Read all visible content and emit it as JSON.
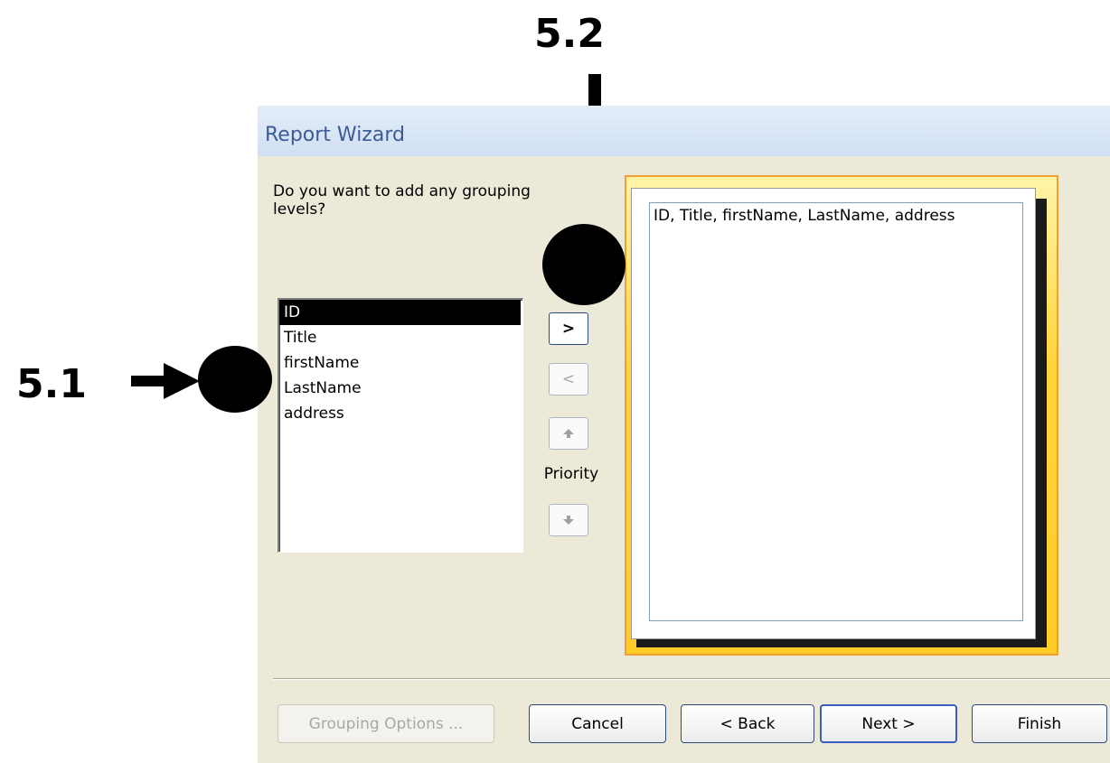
{
  "annotations": {
    "label_5_2": "5.2",
    "label_5_1": "5.1"
  },
  "window": {
    "title": "Report Wizard",
    "question": "Do you want to add any grouping levels?",
    "fields": [
      "ID",
      "Title",
      "firstName",
      "LastName",
      "address"
    ],
    "selected_field": "ID",
    "buttons": {
      "add": ">",
      "remove": "<",
      "priority_label": "Priority"
    },
    "preview_text": "ID, Title, firstName, LastName, address",
    "bottom_buttons": {
      "grouping_options": "Grouping Options ...",
      "cancel": "Cancel",
      "back": "< Back",
      "next": "Next >",
      "finish": "Finish"
    }
  },
  "colors": {
    "accent": "#3c5a96",
    "frame": "#ffcc2a",
    "dialog_bg": "#ece9d8"
  }
}
